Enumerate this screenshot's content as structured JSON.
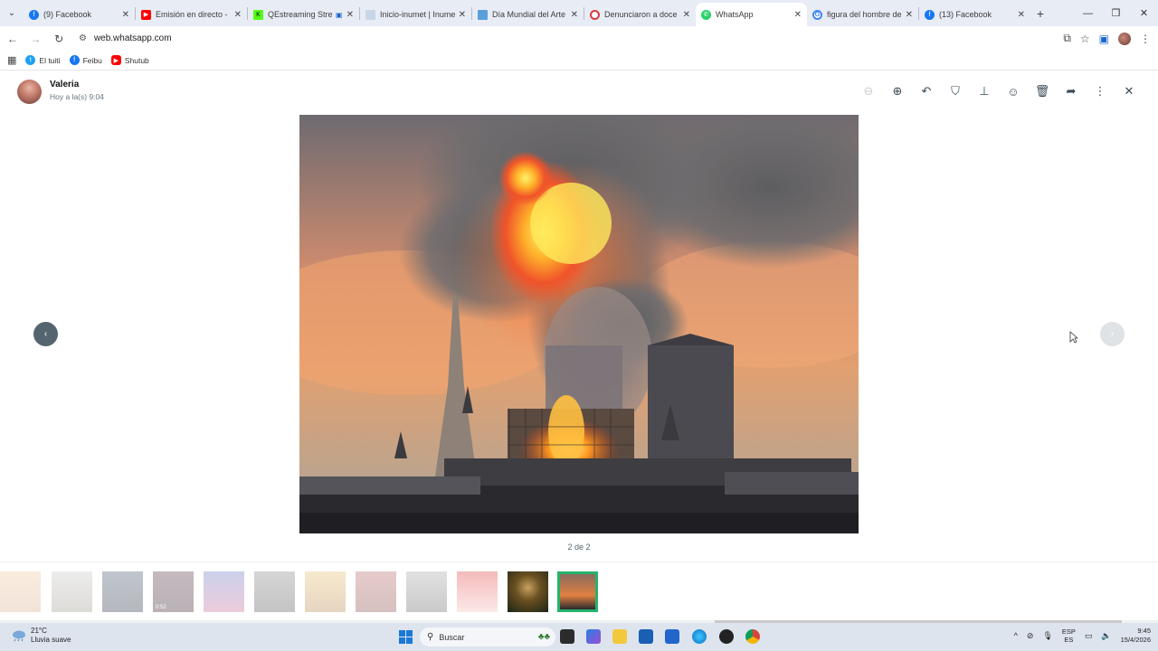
{
  "browser": {
    "tabs": [
      {
        "title": "(9) Facebook",
        "icon": "facebook-icon",
        "color": "#1877f2"
      },
      {
        "title": "Emisión en directo - ",
        "icon": "youtube-icon",
        "color": "#ff0000"
      },
      {
        "title": "QEstreaming Stre",
        "icon": "kick-icon",
        "color": "#53fc18"
      },
      {
        "title": "Inicio-inumet | Inume",
        "icon": "inumet-icon",
        "color": "#9ab6d8"
      },
      {
        "title": "Día Mundial del Arte",
        "icon": "site-icon",
        "color": "#5aa0d8"
      },
      {
        "title": "Denunciaron a doce",
        "icon": "site-icon",
        "color": "#d93b3b"
      },
      {
        "title": "WhatsApp",
        "icon": "whatsapp-icon",
        "color": "#25d366"
      },
      {
        "title": "figura del hombre de",
        "icon": "google-icon",
        "color": "#4285f4"
      },
      {
        "title": "(13) Facebook",
        "icon": "facebook-icon",
        "color": "#1877f2"
      }
    ],
    "url": "web.whatsapp.com",
    "bookmarks": [
      {
        "label": "El tuiti",
        "icon": "twitter-icon",
        "color": "#1da1f2"
      },
      {
        "label": "Feibu",
        "icon": "facebook-icon",
        "color": "#1877f2"
      },
      {
        "label": "Shutub",
        "icon": "youtube-icon",
        "color": "#ff0000"
      }
    ]
  },
  "viewer": {
    "sender": "Valeria",
    "time": "Hoy a la(s) 9:04",
    "counter": "2 de 2",
    "thumb_badge": "0:52"
  },
  "taskbar": {
    "weather_temp": "21°C",
    "weather_desc": "Lluvia suave",
    "search_placeholder": "Buscar",
    "lang_top": "ESP",
    "lang_bottom": "ES",
    "time": "9:45",
    "date": "15/4/2026"
  }
}
